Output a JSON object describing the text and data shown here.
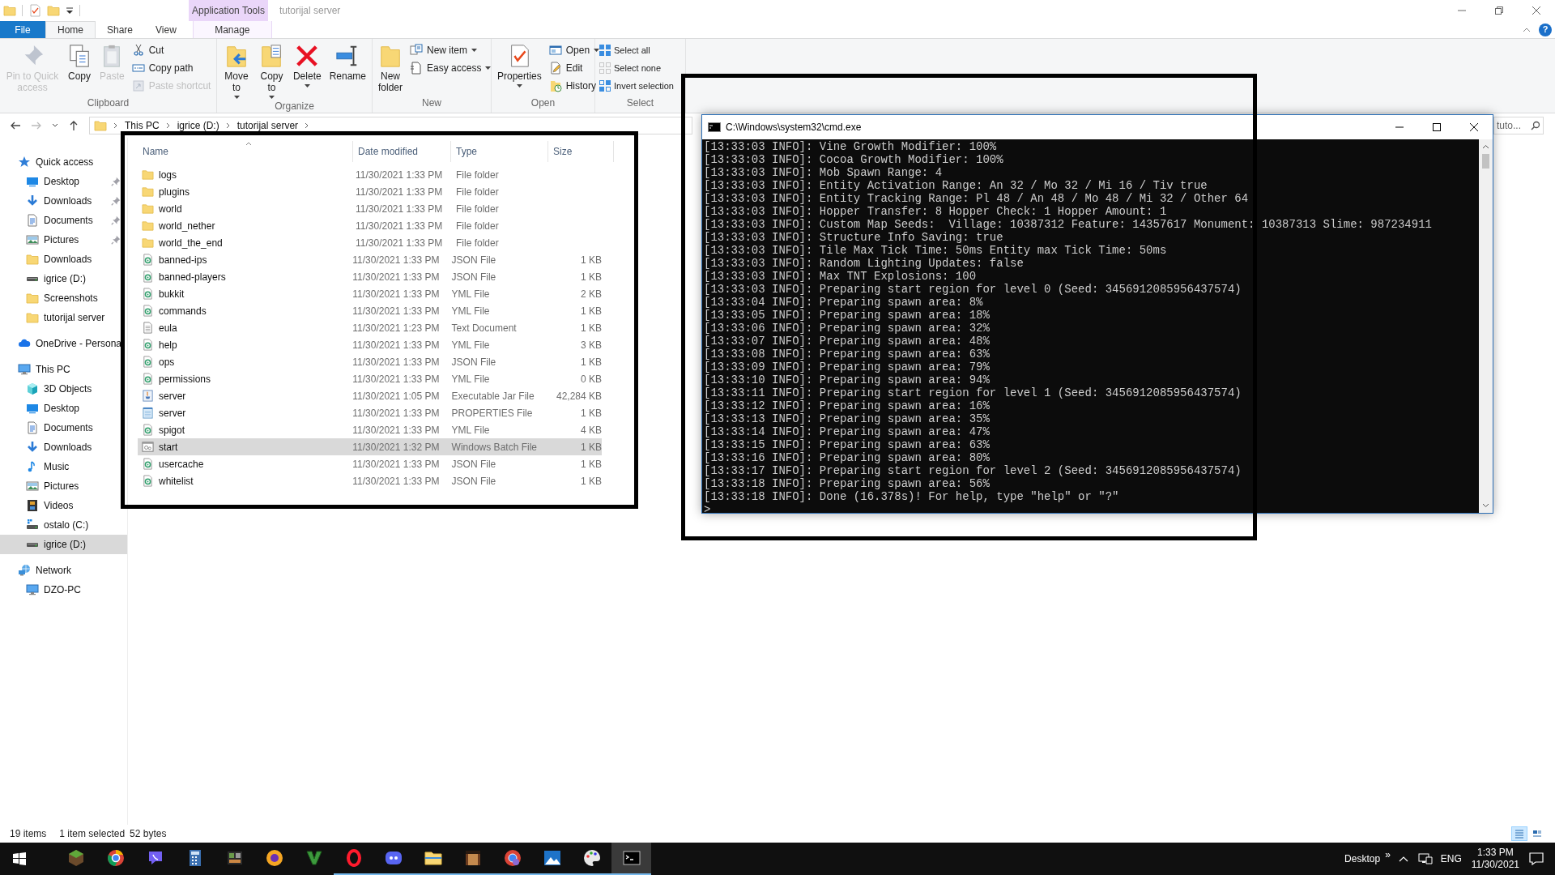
{
  "explorer": {
    "title": "tutorijal server",
    "contextual_tab": "Application Tools",
    "help": "?",
    "ribbon_tabs": [
      {
        "label": "File",
        "kind": "file",
        "selected": false
      },
      {
        "label": "Home",
        "kind": "tab",
        "selected": true
      },
      {
        "label": "Share",
        "kind": "tab",
        "selected": false
      },
      {
        "label": "View",
        "kind": "tab",
        "selected": false
      },
      {
        "label": "Manage",
        "kind": "contextual",
        "selected": false
      }
    ],
    "ribbon_groups": [
      {
        "label": "Clipboard",
        "buttons": [
          {
            "label": "Pin to Quick access",
            "kind": "large",
            "disabled": true,
            "dropdown": false
          },
          {
            "label": "Copy",
            "kind": "large",
            "disabled": false,
            "dropdown": false
          },
          {
            "label": "Paste",
            "kind": "large",
            "disabled": true,
            "dropdown": false
          },
          {
            "label": "Cut",
            "kind": "small",
            "disabled": false,
            "dropdown": false
          },
          {
            "label": "Copy path",
            "kind": "small",
            "disabled": false,
            "dropdown": false
          },
          {
            "label": "Paste shortcut",
            "kind": "small",
            "disabled": true,
            "dropdown": false
          }
        ]
      },
      {
        "label": "Organize",
        "buttons": [
          {
            "label": "Move to",
            "kind": "large",
            "disabled": false,
            "dropdown": true
          },
          {
            "label": "Copy to",
            "kind": "large",
            "disabled": false,
            "dropdown": true
          },
          {
            "label": "Delete",
            "kind": "large",
            "disabled": false,
            "dropdown": true
          },
          {
            "label": "Rename",
            "kind": "large",
            "disabled": false,
            "dropdown": false
          }
        ]
      },
      {
        "label": "New",
        "buttons": [
          {
            "label": "New folder",
            "kind": "large",
            "disabled": false,
            "dropdown": false
          },
          {
            "label": "New item",
            "kind": "small",
            "disabled": false,
            "dropdown": true
          },
          {
            "label": "Easy access",
            "kind": "small",
            "disabled": false,
            "dropdown": true
          }
        ]
      },
      {
        "label": "Open",
        "buttons": [
          {
            "label": "Properties",
            "kind": "large",
            "disabled": false,
            "dropdown": true
          },
          {
            "label": "Open",
            "kind": "small",
            "disabled": false,
            "dropdown": true
          },
          {
            "label": "Edit",
            "kind": "small",
            "disabled": false,
            "dropdown": false
          },
          {
            "label": "History",
            "kind": "small",
            "disabled": false,
            "dropdown": false
          }
        ]
      },
      {
        "label": "Select",
        "buttons": [
          {
            "label": "Select all",
            "kind": "small",
            "disabled": false,
            "dropdown": false
          },
          {
            "label": "Select none",
            "kind": "small",
            "disabled": false,
            "dropdown": false
          },
          {
            "label": "Invert selection",
            "kind": "small",
            "disabled": false,
            "dropdown": false
          }
        ]
      }
    ],
    "breadcrumbs": [
      "This PC",
      "igrice (D:)",
      "tutorijal server"
    ],
    "search": {
      "placeholder": "tuto..."
    },
    "navigation": [
      {
        "label": "Quick access",
        "selected": false,
        "children": [
          {
            "label": "Desktop",
            "selected": false,
            "pinned": true
          },
          {
            "label": "Downloads",
            "selected": false,
            "pinned": true
          },
          {
            "label": "Documents",
            "selected": false,
            "pinned": true
          },
          {
            "label": "Pictures",
            "selected": false,
            "pinned": true
          },
          {
            "label": "Downloads",
            "selected": false,
            "pinned": false
          },
          {
            "label": "igrice (D:)",
            "selected": false,
            "pinned": false
          },
          {
            "label": "Screenshots",
            "selected": false,
            "pinned": false
          },
          {
            "label": "tutorijal server",
            "selected": false,
            "pinned": false
          }
        ]
      },
      {
        "label": "OneDrive - Persona",
        "selected": false
      },
      {
        "label": "This PC",
        "selected": false,
        "children": [
          {
            "label": "3D Objects",
            "selected": false,
            "pinned": false
          },
          {
            "label": "Desktop",
            "selected": false,
            "pinned": false
          },
          {
            "label": "Documents",
            "selected": false,
            "pinned": false
          },
          {
            "label": "Downloads",
            "selected": false,
            "pinned": false
          },
          {
            "label": "Music",
            "selected": false,
            "pinned": false
          },
          {
            "label": "Pictures",
            "selected": false,
            "pinned": false
          },
          {
            "label": "Videos",
            "selected": false,
            "pinned": false
          },
          {
            "label": "ostalo (C:)",
            "selected": false,
            "pinned": false
          },
          {
            "label": "igrice (D:)",
            "selected": true,
            "pinned": false
          }
        ]
      },
      {
        "label": "Network",
        "selected": false,
        "children": [
          {
            "label": "DZO-PC",
            "selected": false,
            "pinned": false
          }
        ]
      }
    ],
    "files": {
      "columns": [
        {
          "label": "Name",
          "sorted": true
        },
        {
          "label": "Date modified",
          "sorted": false
        },
        {
          "label": "Type",
          "sorted": false
        },
        {
          "label": "Size",
          "sorted": false
        }
      ],
      "rows": [
        {
          "name": "logs",
          "date": "11/30/2021 1:33 PM",
          "type": "File folder",
          "selected": false
        },
        {
          "name": "plugins",
          "date": "11/30/2021 1:33 PM",
          "type": "File folder",
          "selected": false
        },
        {
          "name": "world",
          "date": "11/30/2021 1:33 PM",
          "type": "File folder",
          "selected": false
        },
        {
          "name": "world_nether",
          "date": "11/30/2021 1:33 PM",
          "type": "File folder",
          "selected": false
        },
        {
          "name": "world_the_end",
          "date": "11/30/2021 1:33 PM",
          "type": "File folder",
          "selected": false
        },
        {
          "name": "banned-ips",
          "date": "11/30/2021 1:33 PM",
          "type": "JSON File",
          "size": "1 KB",
          "selected": false
        },
        {
          "name": "banned-players",
          "date": "11/30/2021 1:33 PM",
          "type": "JSON File",
          "size": "1 KB",
          "selected": false
        },
        {
          "name": "bukkit",
          "date": "11/30/2021 1:33 PM",
          "type": "YML File",
          "size": "2 KB",
          "selected": false
        },
        {
          "name": "commands",
          "date": "11/30/2021 1:33 PM",
          "type": "YML File",
          "size": "1 KB",
          "selected": false
        },
        {
          "name": "eula",
          "date": "11/30/2021 1:23 PM",
          "type": "Text Document",
          "size": "1 KB",
          "selected": false
        },
        {
          "name": "help",
          "date": "11/30/2021 1:33 PM",
          "type": "YML File",
          "size": "3 KB",
          "selected": false
        },
        {
          "name": "ops",
          "date": "11/30/2021 1:33 PM",
          "type": "JSON File",
          "size": "1 KB",
          "selected": false
        },
        {
          "name": "permissions",
          "date": "11/30/2021 1:33 PM",
          "type": "YML File",
          "size": "0 KB",
          "selected": false
        },
        {
          "name": "server",
          "date": "11/30/2021 1:05 PM",
          "type": "Executable Jar File",
          "size": "42,284 KB",
          "selected": false
        },
        {
          "name": "server",
          "date": "11/30/2021 1:33 PM",
          "type": "PROPERTIES File",
          "size": "1 KB",
          "selected": false
        },
        {
          "name": "spigot",
          "date": "11/30/2021 1:33 PM",
          "type": "YML File",
          "size": "4 KB",
          "selected": false
        },
        {
          "name": "start",
          "date": "11/30/2021 1:32 PM",
          "type": "Windows Batch File",
          "size": "1 KB",
          "selected": true
        },
        {
          "name": "usercache",
          "date": "11/30/2021 1:33 PM",
          "type": "JSON File",
          "size": "1 KB",
          "selected": false
        },
        {
          "name": "whitelist",
          "date": "11/30/2021 1:33 PM",
          "type": "JSON File",
          "size": "1 KB",
          "selected": false
        }
      ]
    },
    "status_bar": {
      "item_count": "19 items",
      "selection": "1 item selected",
      "selection_size": "52 bytes",
      "views": [
        {
          "selected": true
        },
        {
          "selected": false
        }
      ]
    }
  },
  "console": {
    "title": "C:\\Windows\\system32\\cmd.exe",
    "lines": [
      "[13:33:03 INFO]: Vine Growth Modifier: 100%",
      "[13:33:03 INFO]: Cocoa Growth Modifier: 100%",
      "[13:33:03 INFO]: Mob Spawn Range: 4",
      "[13:33:03 INFO]: Entity Activation Range: An 32 / Mo 32 / Mi 16 / Tiv true",
      "[13:33:03 INFO]: Entity Tracking Range: Pl 48 / An 48 / Mo 48 / Mi 32 / Other 64",
      "[13:33:03 INFO]: Hopper Transfer: 8 Hopper Check: 1 Hopper Amount: 1",
      "[13:33:03 INFO]: Custom Map Seeds:  Village: 10387312 Feature: 14357617 Monument: 10387313 Slime: 987234911",
      "[13:33:03 INFO]: Structure Info Saving: true",
      "[13:33:03 INFO]: Tile Max Tick Time: 50ms Entity max Tick Time: 50ms",
      "[13:33:03 INFO]: Random Lighting Updates: false",
      "[13:33:03 INFO]: Max TNT Explosions: 100",
      "[13:33:03 INFO]: Preparing start region for level 0 (Seed: 3456912085956437574)",
      "[13:33:04 INFO]: Preparing spawn area: 8%",
      "[13:33:05 INFO]: Preparing spawn area: 18%",
      "[13:33:06 INFO]: Preparing spawn area: 32%",
      "[13:33:07 INFO]: Preparing spawn area: 48%",
      "[13:33:08 INFO]: Preparing spawn area: 63%",
      "[13:33:09 INFO]: Preparing spawn area: 79%",
      "[13:33:10 INFO]: Preparing spawn area: 94%",
      "[13:33:11 INFO]: Preparing start region for level 1 (Seed: 3456912085956437574)",
      "[13:33:12 INFO]: Preparing spawn area: 16%",
      "[13:33:13 INFO]: Preparing spawn area: 35%",
      "[13:33:14 INFO]: Preparing spawn area: 47%",
      "[13:33:15 INFO]: Preparing spawn area: 63%",
      "[13:33:16 INFO]: Preparing spawn area: 80%",
      "[13:33:17 INFO]: Preparing start region for level 2 (Seed: 3456912085956437574)",
      "[13:33:18 INFO]: Preparing spawn area: 56%",
      "[13:33:18 INFO]: Done (16.378s)! For help, type \"help\" or \"?\""
    ],
    "prompt": ">"
  },
  "taskbar": {
    "apps": [
      {
        "running": false,
        "active": false
      },
      {
        "running": false,
        "active": false
      },
      {
        "running": false,
        "active": false
      },
      {
        "running": false,
        "active": false
      },
      {
        "running": false,
        "active": false
      },
      {
        "running": false,
        "active": false
      },
      {
        "running": false,
        "active": false
      },
      {
        "running": true,
        "active": false
      },
      {
        "running": true,
        "active": false
      },
      {
        "running": true,
        "active": false
      },
      {
        "running": true,
        "active": false
      },
      {
        "running": true,
        "active": false
      },
      {
        "running": true,
        "active": false
      },
      {
        "running": true,
        "active": false
      },
      {
        "running": true,
        "active": true
      }
    ],
    "toolbar": "Desktop",
    "toolbar_more": "»",
    "language": "ENG",
    "time": "1:33 PM",
    "date": "11/30/2021"
  }
}
